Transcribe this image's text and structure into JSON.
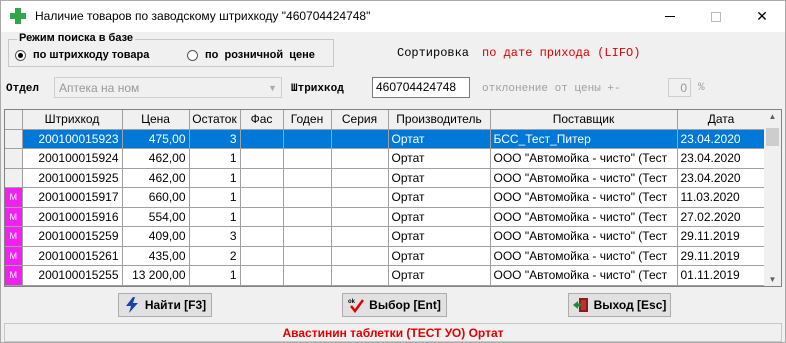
{
  "window": {
    "title": "Наличие товаров по заводскому штрихкоду \"460704424748\""
  },
  "search_mode": {
    "title": "Режим поиска в базе",
    "option_barcode": "по штрихкоду товара",
    "option_price": "по  розничной  цене"
  },
  "sort": {
    "label": "Сортировка",
    "value": "по дате прихода (LIFO)"
  },
  "filters": {
    "dept_label": "Отдел",
    "dept_value": "Аптека на ном",
    "barcode_label": "Штрихкод",
    "barcode_value": "460704424748",
    "deviation_label": "отклонение от цены +-",
    "deviation_value": "0",
    "deviation_unit": "%"
  },
  "table": {
    "columns": [
      "Штрихкод",
      "Цена",
      "Остаток",
      "Фас",
      "Годен",
      "Серия",
      "Производитель",
      "Поставщик",
      "Дата"
    ],
    "rows": [
      {
        "marker": "",
        "cells": [
          "200100015923",
          "475,00",
          "3",
          "",
          "",
          "",
          "Ортат",
          "БСС_Тест_Питер",
          "23.04.2020"
        ]
      },
      {
        "marker": "",
        "cells": [
          "200100015924",
          "462,00",
          "1",
          "",
          "",
          "",
          "Ортат",
          "ООО \"Автомойка - чисто\" (Тест",
          "23.04.2020"
        ]
      },
      {
        "marker": "",
        "cells": [
          "200100015925",
          "462,00",
          "1",
          "",
          "",
          "",
          "Ортат",
          "ООО \"Автомойка - чисто\" (Тест",
          "23.04.2020"
        ]
      },
      {
        "marker": "M",
        "cells": [
          "200100015917",
          "660,00",
          "1",
          "",
          "",
          "",
          "Ортат",
          "ООО \"Автомойка - чисто\" (Тест",
          "11.03.2020"
        ]
      },
      {
        "marker": "M",
        "cells": [
          "200100015916",
          "554,00",
          "1",
          "",
          "",
          "",
          "Ортат",
          "ООО \"Автомойка - чисто\" (Тест",
          "27.02.2020"
        ]
      },
      {
        "marker": "M",
        "cells": [
          "200100015259",
          "409,00",
          "3",
          "",
          "",
          "",
          "Ортат",
          "ООО \"Автомойка - чисто\" (Тест",
          "29.11.2019"
        ]
      },
      {
        "marker": "M",
        "cells": [
          "200100015261",
          "435,00",
          "2",
          "",
          "",
          "",
          "Ортат",
          "ООО \"Автомойка - чисто\" (Тест",
          "29.11.2019"
        ]
      },
      {
        "marker": "M",
        "cells": [
          "200100015255",
          "13 200,00",
          "1",
          "",
          "",
          "",
          "Ортат",
          "ООО \"Автомойка - чисто\" (Тест",
          "01.11.2019"
        ]
      }
    ]
  },
  "buttons": {
    "find": "Найти [F3]",
    "choose": "Выбор [Ent]",
    "exit": "Выход [Esc]"
  },
  "status": {
    "text": "Авастинин таблетки (ТЕСТ УО) Ортат"
  },
  "colors": {
    "selection": "#0078d7",
    "marker": "#f020f0",
    "accent_red": "#e00000",
    "app_icon_green": "#2ea84a"
  }
}
